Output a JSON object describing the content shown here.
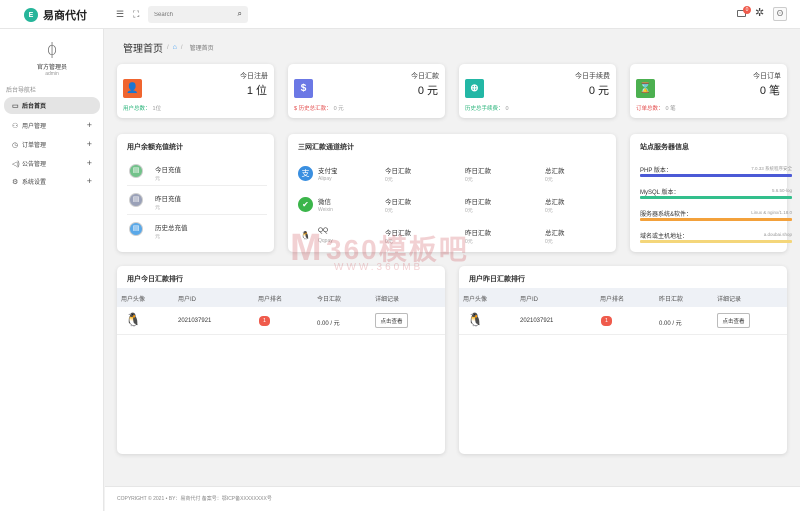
{
  "brand": {
    "logo_mark": "E",
    "name": "易商代付"
  },
  "topbar": {
    "search_placeholder": "Search",
    "menu_icon": "☰",
    "fullscreen_icon": "⛶",
    "search_icon": "⌕",
    "notif_count": "0",
    "gear_icon": "✲",
    "avatar_icon": "ʘ"
  },
  "sidebar": {
    "avatar_icon": "ᛰ",
    "user_name": "官方管理员",
    "user_role": "admin",
    "section": "后台导航栏",
    "items": [
      {
        "label": "后台首页",
        "icon": "▭",
        "active": true,
        "has_plus": false
      },
      {
        "label": "用户管理",
        "icon": "⚇",
        "active": false,
        "has_plus": true,
        "plus": "+"
      },
      {
        "label": "订单管理",
        "icon": "◷",
        "active": false,
        "has_plus": true,
        "plus": "+"
      },
      {
        "label": "公告管理",
        "icon": "◁)",
        "active": false,
        "has_plus": true,
        "plus": "+"
      },
      {
        "label": "系统设置",
        "icon": "⚙",
        "active": false,
        "has_plus": true,
        "plus": "+"
      }
    ]
  },
  "breadcrumb": {
    "title": "管理首页",
    "sep": "/",
    "home_icon": "⌂",
    "current": "管理首页"
  },
  "stats": [
    {
      "title": "今日注册",
      "value": "1 位",
      "icon": "👤",
      "color": "#f0652f",
      "sub_label": "用户总数：",
      "sub_value": "1位",
      "sub_color": "#29b47a"
    },
    {
      "title": "今日汇款",
      "value": "0 元",
      "icon": "$",
      "color": "#6b78e5",
      "sub_label": "$ 历史总汇款：",
      "sub_value": "0 元",
      "sub_color": "#e44f4f"
    },
    {
      "title": "今日手续费",
      "value": "0 元",
      "icon": "⊕",
      "color": "#23b7a5",
      "sub_label": "历史总手续费：",
      "sub_value": "0",
      "sub_color": "#29b47a"
    },
    {
      "title": "今日订单",
      "value": "0 笔",
      "icon": "⌛",
      "color": "#4cb050",
      "sub_label": "订单总数：",
      "sub_value": "0 笔",
      "sub_color": "#e44f4f"
    }
  ],
  "recharge": {
    "title": "用户余额充值统计",
    "rows": [
      {
        "label": "今日充值",
        "unit": "元",
        "icon_color": "#72c28a"
      },
      {
        "label": "昨日充值",
        "unit": "元",
        "icon_color": "#9aa1b8"
      },
      {
        "label": "历史总充值",
        "unit": "元",
        "icon_color": "#5aa8e8"
      }
    ]
  },
  "channels": {
    "title": "三网汇款通道统计",
    "col_labels": [
      "今日汇款",
      "昨日汇款",
      "总汇款"
    ],
    "col_unit": "0元",
    "rows": [
      {
        "name": "支付宝",
        "sub": "Alipay",
        "icon": "支",
        "color": "#3a8fe0"
      },
      {
        "name": "微信",
        "sub": "Weixin",
        "icon": "✔",
        "color": "#3bb54a"
      },
      {
        "name": "QQ",
        "sub": "Qqpay",
        "icon": "🐧",
        "color": "#ffffff"
      }
    ]
  },
  "server": {
    "title": "站点服务器信息",
    "rows": [
      {
        "label": "PHP 版本：",
        "value": "7.0.33 系统程序安全",
        "color": "#4b5ad6"
      },
      {
        "label": "MySQL 版本：",
        "value": "5.6.50-log",
        "color": "#33bf8c"
      },
      {
        "label": "服务器系统&软件：",
        "value": "Linux & nginx/1.18.0",
        "color": "#f3a13b"
      },
      {
        "label": "域名或主机地址：",
        "value": "a.doubai.shop",
        "color": "#f4d67a"
      }
    ]
  },
  "today_rank": {
    "title": "用户今日汇款排行",
    "headers": [
      "用户头像",
      "用户ID",
      "用户排名",
      "今日汇款",
      "详细记录"
    ],
    "row": {
      "avatar": "🐧",
      "user_id": "2021037921",
      "rank": "1",
      "amount": "0.00 / 元",
      "button": "点击查看"
    }
  },
  "yesterday_rank": {
    "title": "用户昨日汇款排行",
    "headers": [
      "用户头像",
      "用户ID",
      "用户排名",
      "昨日汇款",
      "详细记录"
    ],
    "row": {
      "avatar": "🐧",
      "user_id": "2021037921",
      "rank": "1",
      "amount": "0.00 / 元",
      "button": "点击查看"
    }
  },
  "watermark": {
    "mark": "M",
    "text": "360模板吧",
    "sub": "WWW.360MB"
  },
  "footer": {
    "text": "COPYRIGHT © 2021 • BY：易商代付   备案号：鄂ICP备XXXXXXXX号"
  }
}
